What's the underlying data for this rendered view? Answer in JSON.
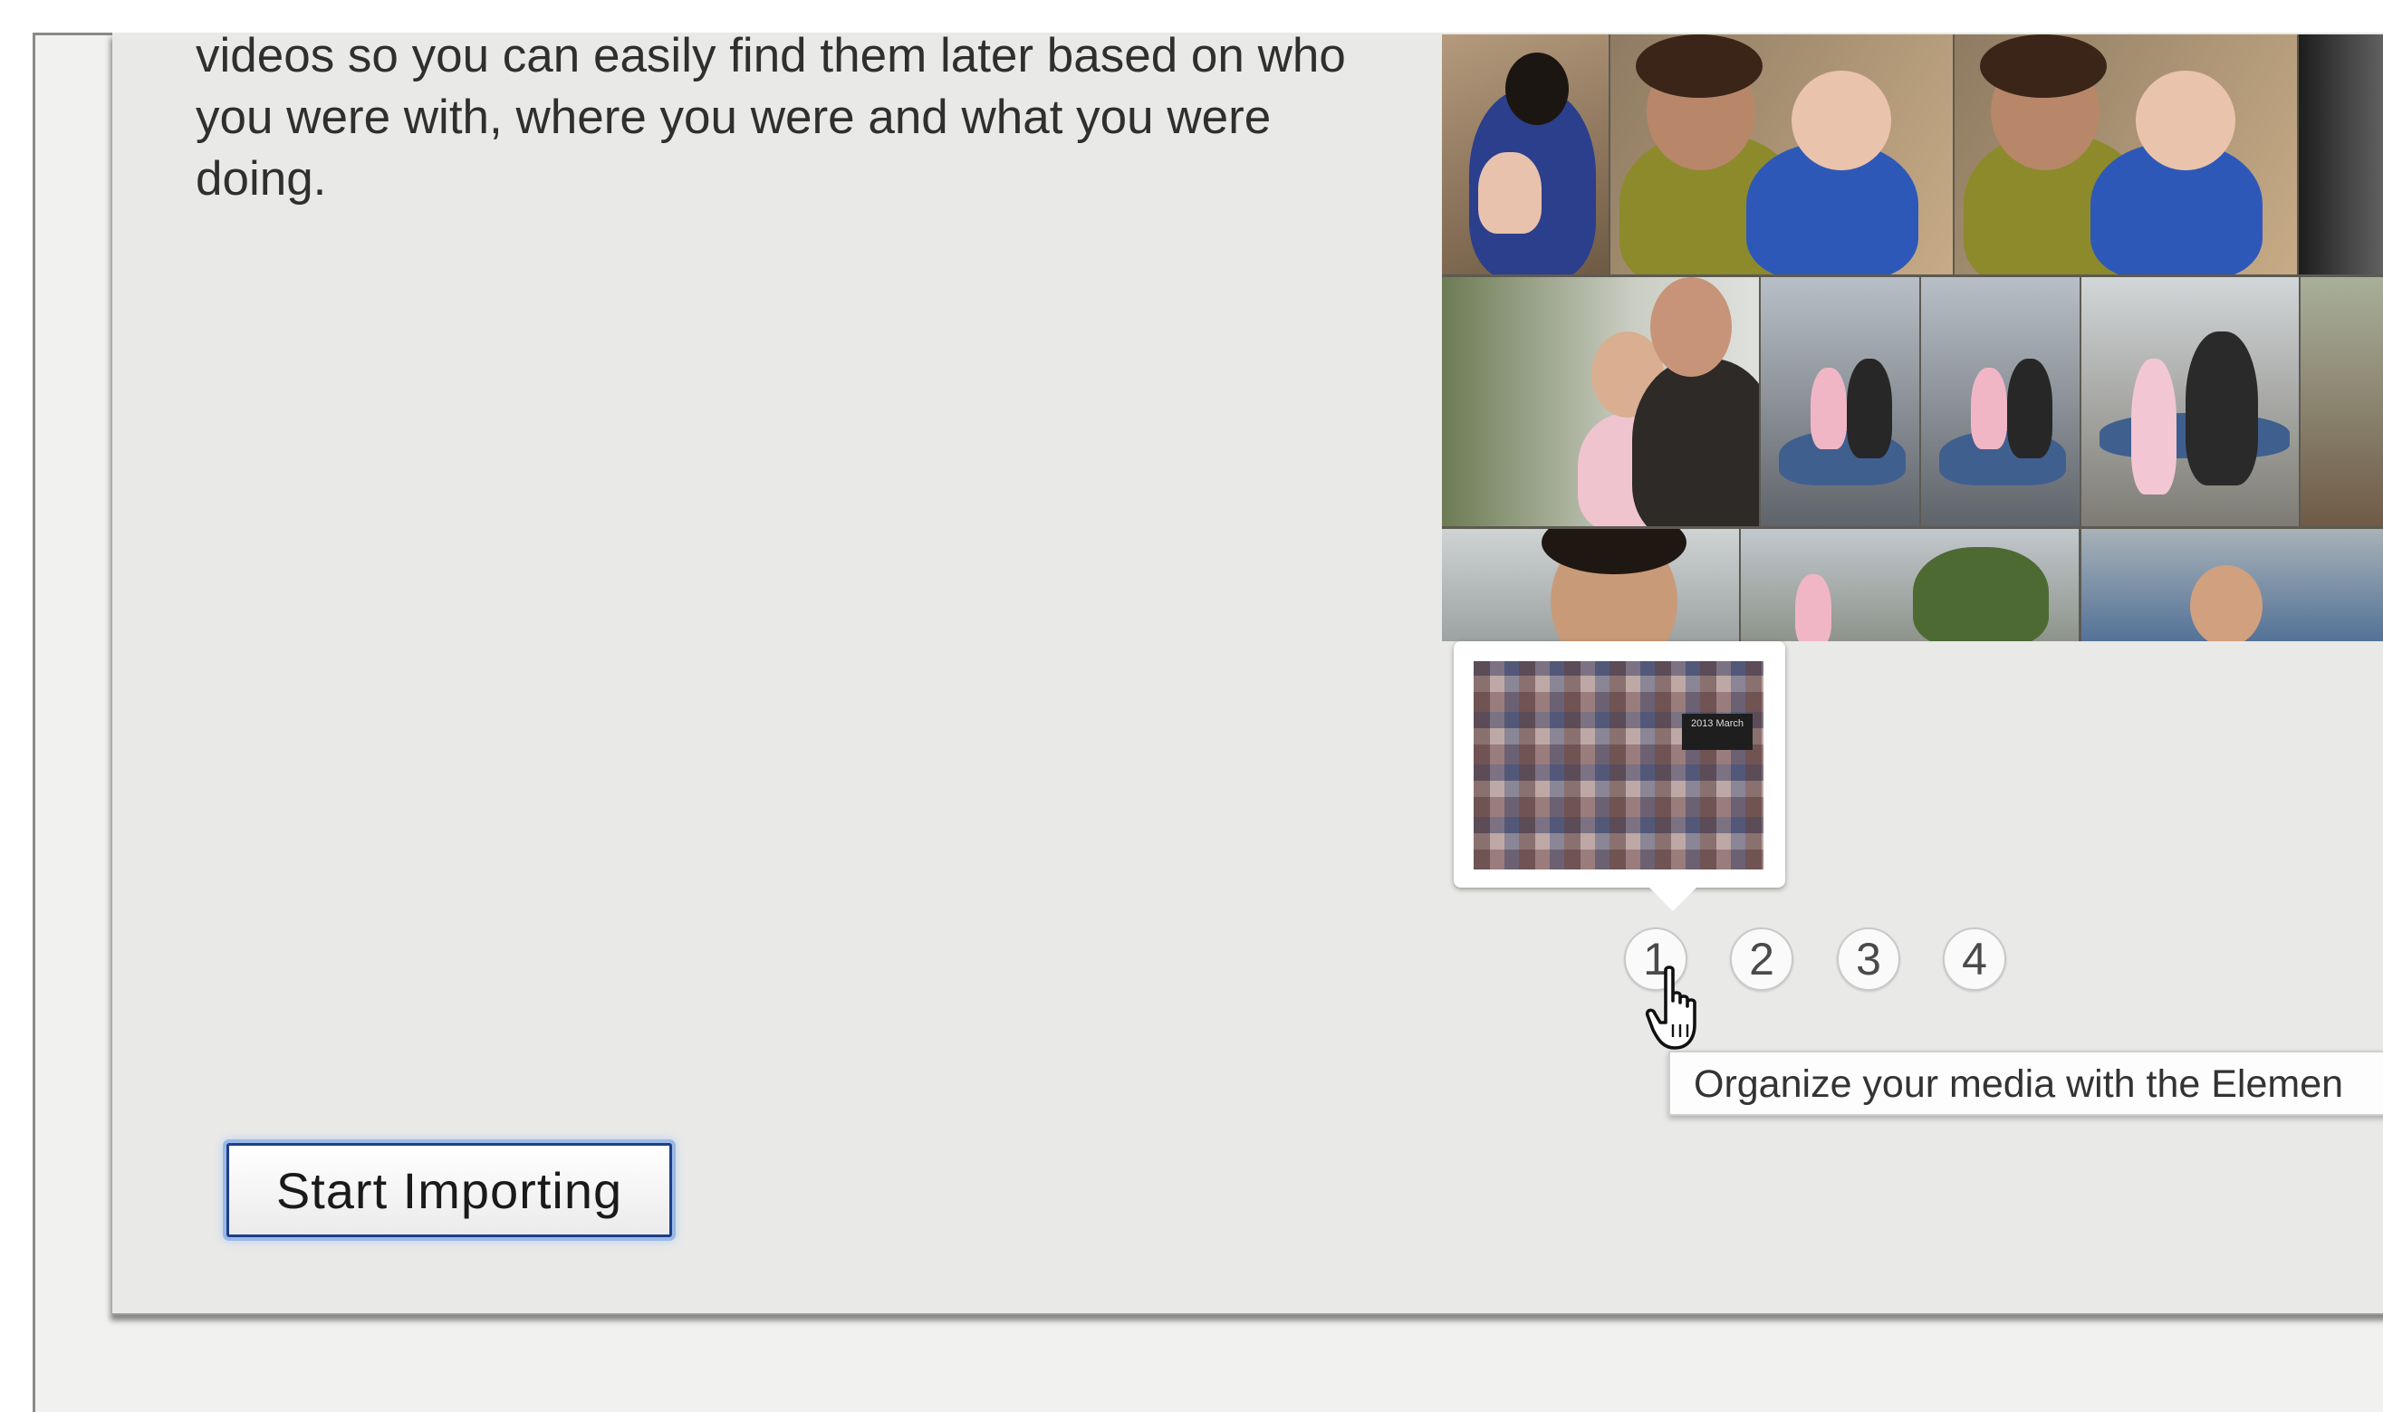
{
  "description_text": "videos so you can easily find them later based on who you were with, where you were and what you were doing.",
  "preview_badge_text": "2013 March",
  "pager": {
    "pages": [
      "1",
      "2",
      "3",
      "4"
    ],
    "current_page": "1"
  },
  "tooltip_text": "Organize your media with the Elemen",
  "start_button_label": "Start Importing",
  "colors": {
    "panel_bg": "#e9e9e7",
    "button_focus_ring": "#1d3f8a",
    "text": "#2f2f2f"
  },
  "icons": {
    "cursor": "pointing-hand-cursor-icon"
  }
}
